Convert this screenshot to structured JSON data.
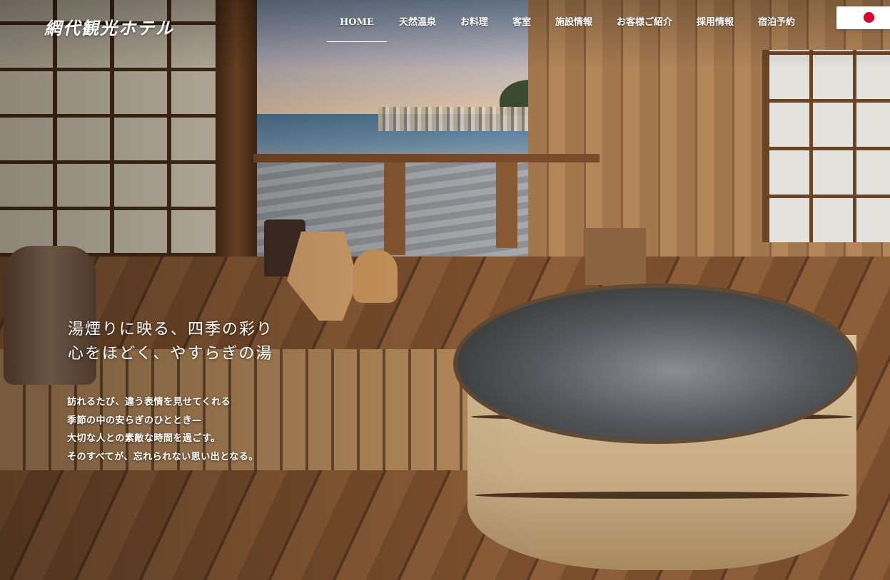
{
  "header": {
    "logo_text": "網代観光ホテル",
    "nav": [
      {
        "label": "HOME",
        "active": true
      },
      {
        "label": "天然温泉"
      },
      {
        "label": "お料理"
      },
      {
        "label": "客室"
      },
      {
        "label": "施設情報"
      },
      {
        "label": "お客様ご紹介"
      },
      {
        "label": "採用情報"
      },
      {
        "label": "宿泊予約"
      }
    ],
    "language_icon": "japan-flag-icon"
  },
  "hero": {
    "headline": [
      "湯煙りに映る、四季の彩り",
      "心をほどく、やすらぎの湯"
    ],
    "body": [
      "訪れるたび、違う表情を見せてくれる",
      "季節の中の安らぎのひととき—",
      "大切な人との素敵な時間を過ごす。",
      "そのすべてが、忘れられない思い出となる。"
    ]
  },
  "colors": {
    "flag_red": "#d9002b",
    "text": "#ffffff"
  }
}
